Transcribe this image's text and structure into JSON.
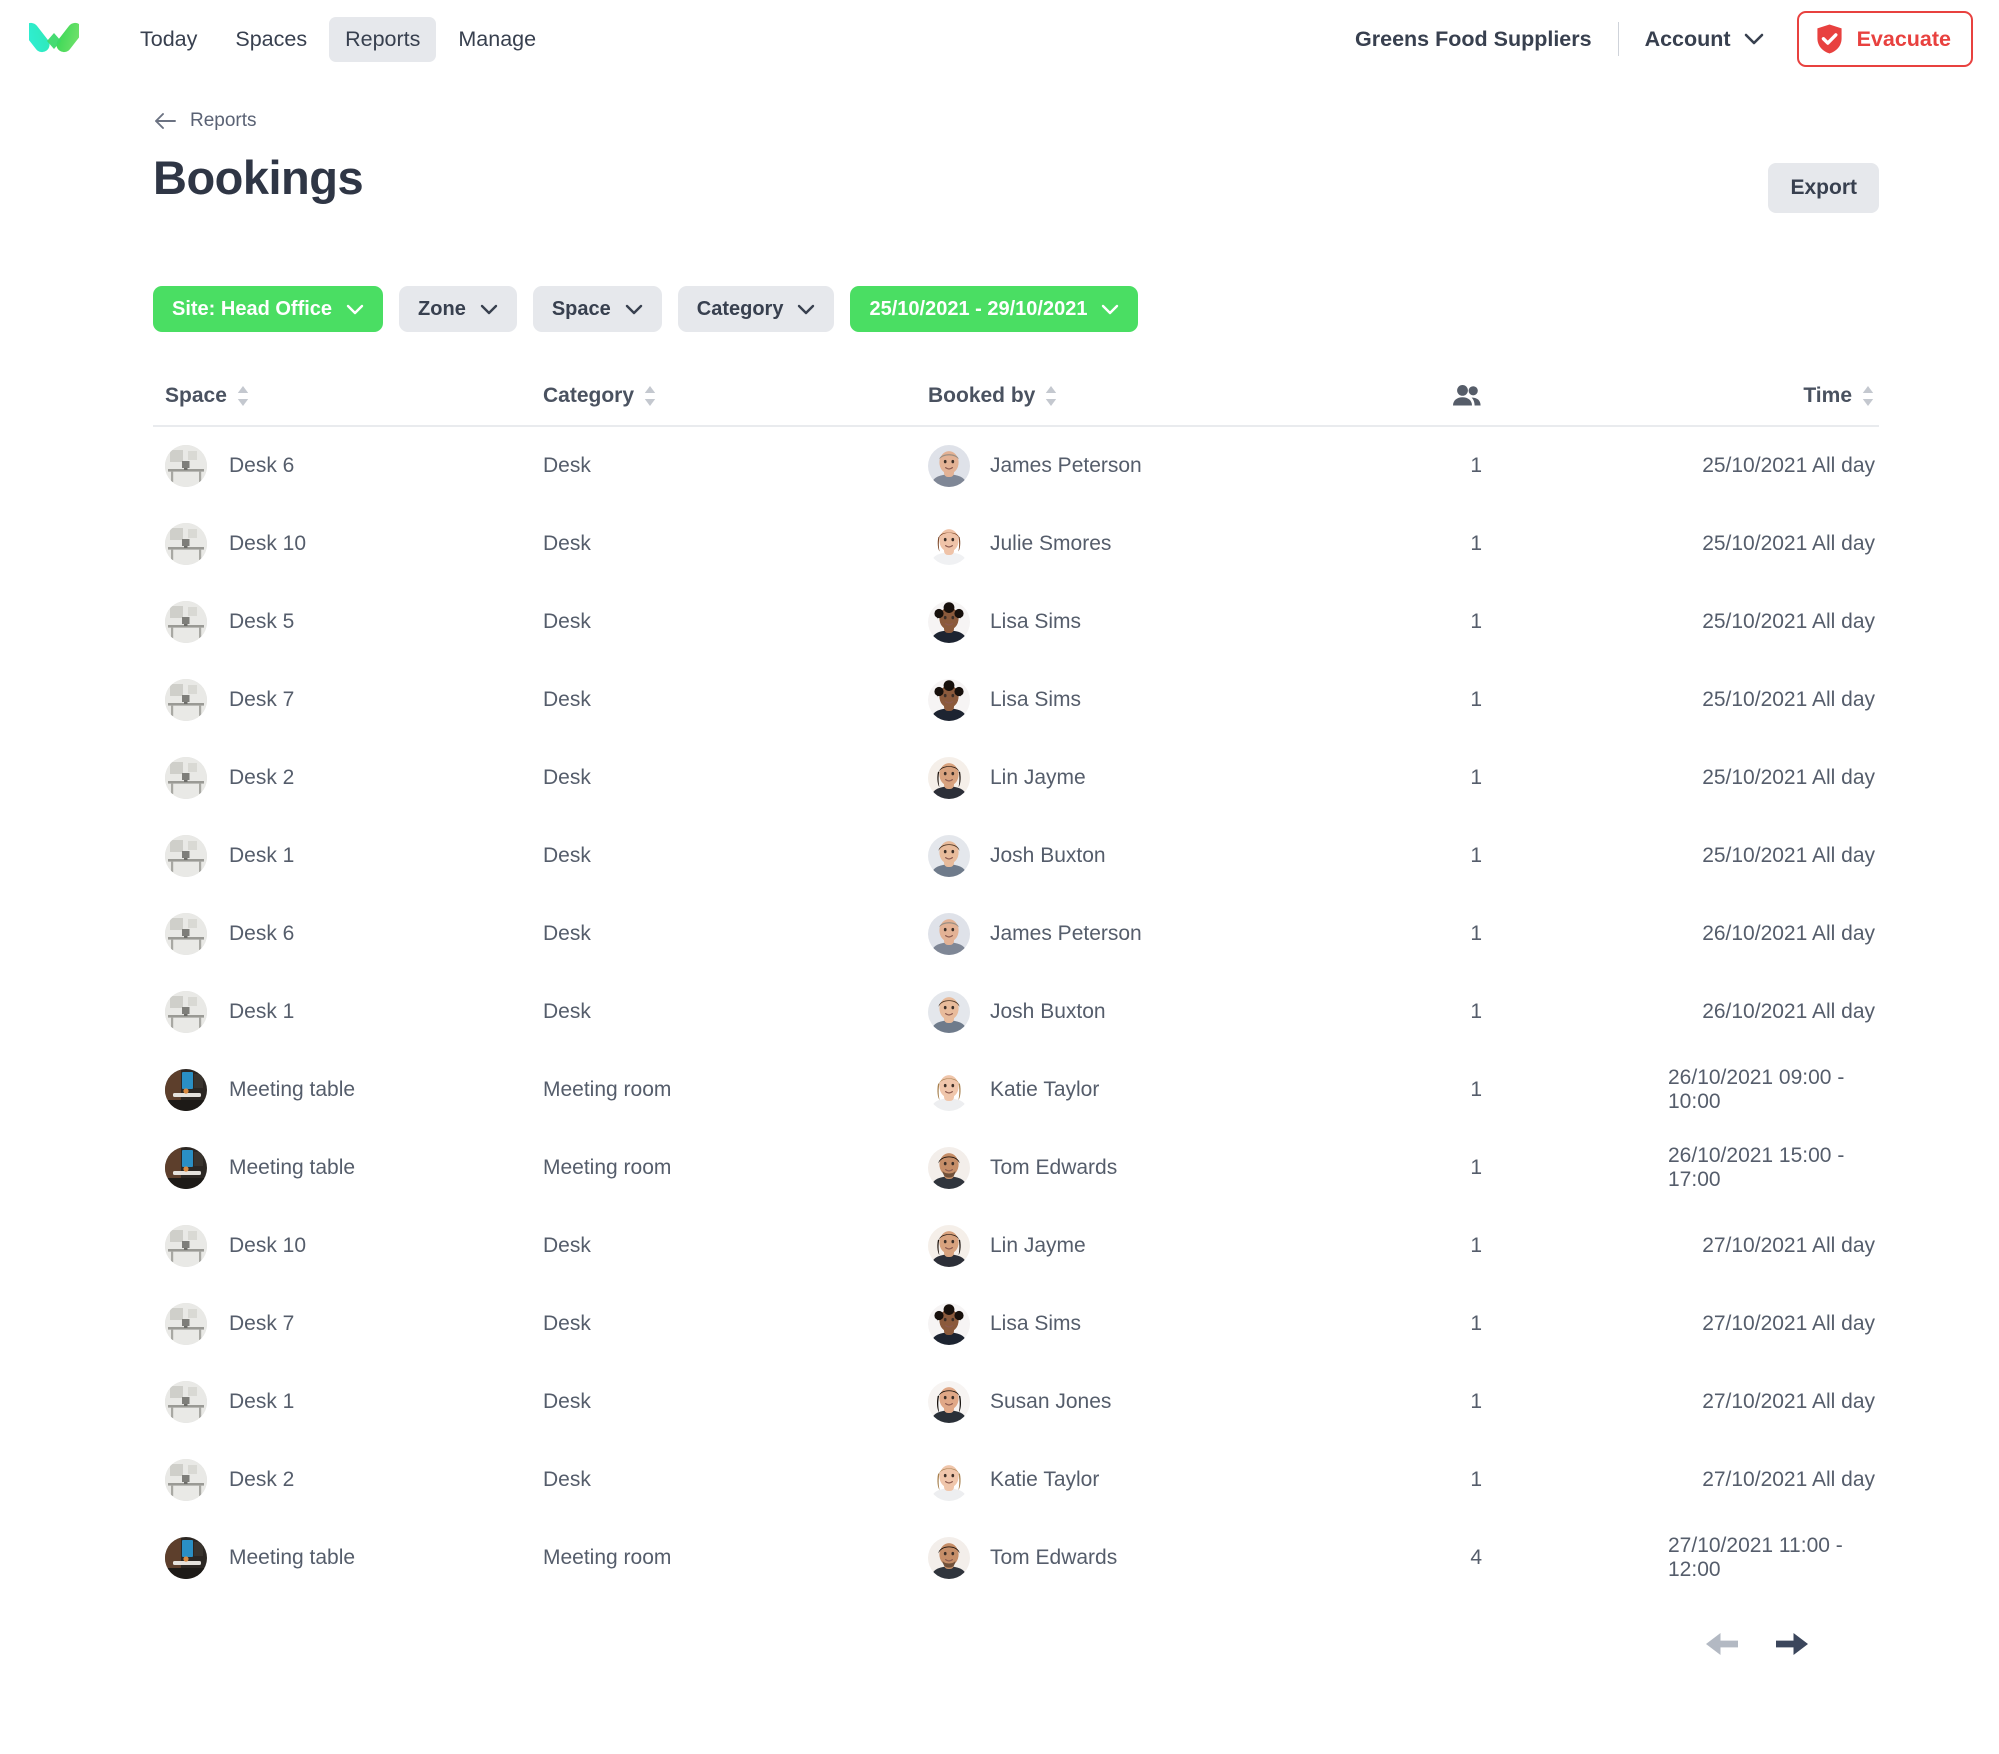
{
  "brand": {
    "logo_icon": "v-check-logo",
    "accent_green": "#4ade63",
    "accent_cyan": "#34e6d0",
    "danger_red": "#e8413f"
  },
  "topnav": {
    "links": [
      {
        "label": "Today",
        "active": false
      },
      {
        "label": "Spaces",
        "active": false
      },
      {
        "label": "Reports",
        "active": true
      },
      {
        "label": "Manage",
        "active": false
      }
    ],
    "org_name": "Greens Food Suppliers",
    "account_label": "Account",
    "account_chevron_icon": "chevron-down-icon",
    "evacuate_label": "Evacuate",
    "evacuate_icon": "shield-check-icon"
  },
  "breadcrumb": {
    "back_icon": "arrow-left-icon",
    "label": "Reports"
  },
  "header": {
    "title": "Bookings",
    "export_label": "Export"
  },
  "filters": [
    {
      "label": "Site: Head Office",
      "style": "green",
      "chevron_icon": "chevron-down-icon"
    },
    {
      "label": "Zone",
      "style": "grey",
      "chevron_icon": "chevron-down-icon"
    },
    {
      "label": "Space",
      "style": "grey",
      "chevron_icon": "chevron-down-icon"
    },
    {
      "label": "Category",
      "style": "grey",
      "chevron_icon": "chevron-down-icon"
    },
    {
      "label": "25/10/2021 - 29/10/2021",
      "style": "green",
      "chevron_icon": "chevron-down-icon"
    }
  ],
  "table": {
    "columns": [
      {
        "key": "space",
        "label": "Space",
        "sortable": true,
        "sort_icon": "sort-updown-icon"
      },
      {
        "key": "category",
        "label": "Category",
        "sortable": true,
        "sort_icon": "sort-updown-icon"
      },
      {
        "key": "booked_by",
        "label": "Booked by",
        "sortable": true,
        "sort_icon": "sort-updown-icon"
      },
      {
        "key": "people",
        "label": "",
        "icon": "people-icon",
        "sortable": false
      },
      {
        "key": "time",
        "label": "Time",
        "sortable": true,
        "sort_icon": "sort-updown-icon"
      }
    ],
    "rows": [
      {
        "space": "Desk 6",
        "space_thumb": "desk",
        "category": "Desk",
        "booked_by": "James Peterson",
        "avatar": "james",
        "people": "1",
        "time": "25/10/2021 All day"
      },
      {
        "space": "Desk 10",
        "space_thumb": "desk",
        "category": "Desk",
        "booked_by": "Julie Smores",
        "avatar": "julie",
        "people": "1",
        "time": "25/10/2021 All day"
      },
      {
        "space": "Desk 5",
        "space_thumb": "desk",
        "category": "Desk",
        "booked_by": "Lisa Sims",
        "avatar": "lisa",
        "people": "1",
        "time": "25/10/2021 All day"
      },
      {
        "space": "Desk 7",
        "space_thumb": "desk",
        "category": "Desk",
        "booked_by": "Lisa Sims",
        "avatar": "lisa",
        "people": "1",
        "time": "25/10/2021 All day"
      },
      {
        "space": "Desk 2",
        "space_thumb": "desk",
        "category": "Desk",
        "booked_by": "Lin Jayme",
        "avatar": "lin",
        "people": "1",
        "time": "25/10/2021 All day"
      },
      {
        "space": "Desk 1",
        "space_thumb": "desk",
        "category": "Desk",
        "booked_by": "Josh Buxton",
        "avatar": "josh",
        "people": "1",
        "time": "25/10/2021 All day"
      },
      {
        "space": "Desk 6",
        "space_thumb": "desk",
        "category": "Desk",
        "booked_by": "James Peterson",
        "avatar": "james",
        "people": "1",
        "time": "26/10/2021 All day"
      },
      {
        "space": "Desk 1",
        "space_thumb": "desk",
        "category": "Desk",
        "booked_by": "Josh Buxton",
        "avatar": "josh",
        "people": "1",
        "time": "26/10/2021 All day"
      },
      {
        "space": "Meeting table",
        "space_thumb": "meeting",
        "category": "Meeting room",
        "booked_by": "Katie Taylor",
        "avatar": "katie",
        "people": "1",
        "time": "26/10/2021 09:00 - 10:00"
      },
      {
        "space": "Meeting table",
        "space_thumb": "meeting",
        "category": "Meeting room",
        "booked_by": "Tom Edwards",
        "avatar": "tom",
        "people": "1",
        "time": "26/10/2021 15:00 - 17:00"
      },
      {
        "space": "Desk 10",
        "space_thumb": "desk",
        "category": "Desk",
        "booked_by": "Lin Jayme",
        "avatar": "lin",
        "people": "1",
        "time": "27/10/2021 All day"
      },
      {
        "space": "Desk 7",
        "space_thumb": "desk",
        "category": "Desk",
        "booked_by": "Lisa Sims",
        "avatar": "lisa",
        "people": "1",
        "time": "27/10/2021 All day"
      },
      {
        "space": "Desk 1",
        "space_thumb": "desk",
        "category": "Desk",
        "booked_by": "Susan Jones",
        "avatar": "susan",
        "people": "1",
        "time": "27/10/2021 All day"
      },
      {
        "space": "Desk 2",
        "space_thumb": "desk",
        "category": "Desk",
        "booked_by": "Katie Taylor",
        "avatar": "katie",
        "people": "1",
        "time": "27/10/2021 All day"
      },
      {
        "space": "Meeting table",
        "space_thumb": "meeting",
        "category": "Meeting room",
        "booked_by": "Tom Edwards",
        "avatar": "tom",
        "people": "4",
        "time": "27/10/2021 11:00 - 12:00"
      }
    ]
  },
  "pagination": {
    "prev_icon": "arrow-left-icon",
    "prev_enabled": false,
    "next_icon": "arrow-right-icon",
    "next_enabled": true
  }
}
